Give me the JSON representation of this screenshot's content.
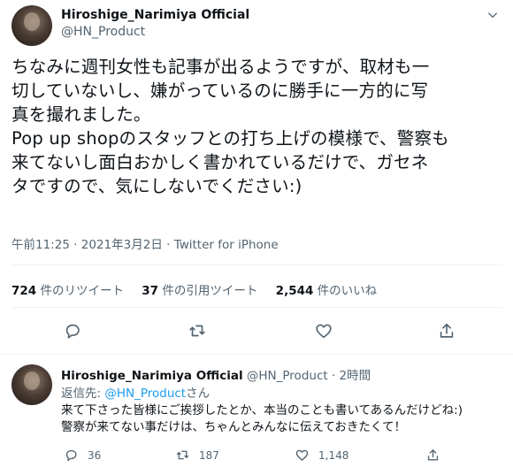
{
  "main_tweet": {
    "author_name": "Hiroshige_Narimiya Official",
    "author_handle": "@HN_Product",
    "text": "ちなみに週刊女性も記事が出るようですが、取材も一\n切していないし、嫌がっているのに勝手に一方的に写\n真を撮れました。\nPop up shopのスタッフとの打ち上げの模様で、警察も\n来てないし面白おかしく書かれているだけで、ガセネ\nタですので、気にしないでください:)",
    "timestamp": "午前11:25 · 2021年3月2日",
    "separator": " · ",
    "source": "Twitter for iPhone",
    "stats": {
      "retweets_count": "724",
      "retweets_label": " 件のリツイート",
      "quotes_count": "37",
      "quotes_label": " 件の引用ツイート",
      "likes_count": "2,544",
      "likes_label": " 件のいいね"
    },
    "action_icons": [
      "reply-icon",
      "retweet-icon",
      "like-icon",
      "share-icon"
    ]
  },
  "reply_tweet": {
    "author_name": "Hiroshige_Narimiya Official",
    "author_handle": " @HN_Product",
    "time_sep": " · ",
    "time": "2時間",
    "reply_prefix": "返信先: ",
    "reply_mention": "@HN_Product",
    "reply_suffix": "さん",
    "text": "来て下さった皆様にご挨拶したとか、本当のことも書いてあるんだけどね:)\n警察が来てない事だけは、ちゃんとみんなに伝えておきたくて！",
    "replies": "36",
    "retweets": "187",
    "likes": "1,148"
  },
  "colors": {
    "text": "#0f1419",
    "secondary": "#536471",
    "link": "#1d9bf0",
    "divider": "#eff3f4"
  }
}
